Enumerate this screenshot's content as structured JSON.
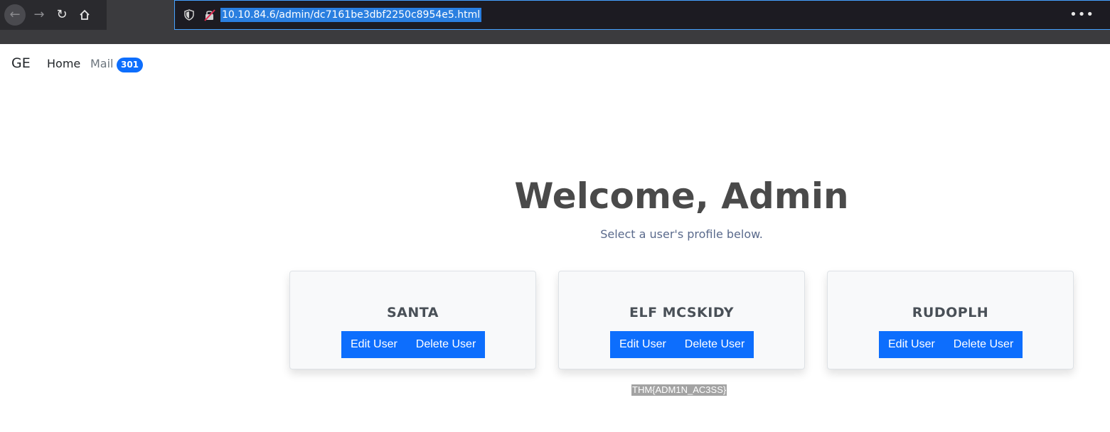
{
  "browser": {
    "url": "10.10.84.6/admin/dc7161be3dbf2250c8954e5.html",
    "menu_glyph": "•••"
  },
  "navbar": {
    "brand": "GE",
    "home": "Home",
    "mail": "Mail",
    "mail_count": "301"
  },
  "hero": {
    "title": "Welcome, Admin",
    "subtitle": "Select a user's profile below."
  },
  "users": [
    {
      "name": "SANTA",
      "edit": "Edit User",
      "delete": "Delete User"
    },
    {
      "name": "ELF MCSKIDY",
      "edit": "Edit User",
      "delete": "Delete User"
    },
    {
      "name": "RUDOPLH",
      "edit": "Edit User",
      "delete": "Delete User"
    }
  ],
  "flag": "THM{ADM1N_AC3SS}",
  "colors": {
    "primary": "#0d6efd",
    "url_highlight": "#2a7fe0",
    "url_border": "#45a1ff"
  }
}
